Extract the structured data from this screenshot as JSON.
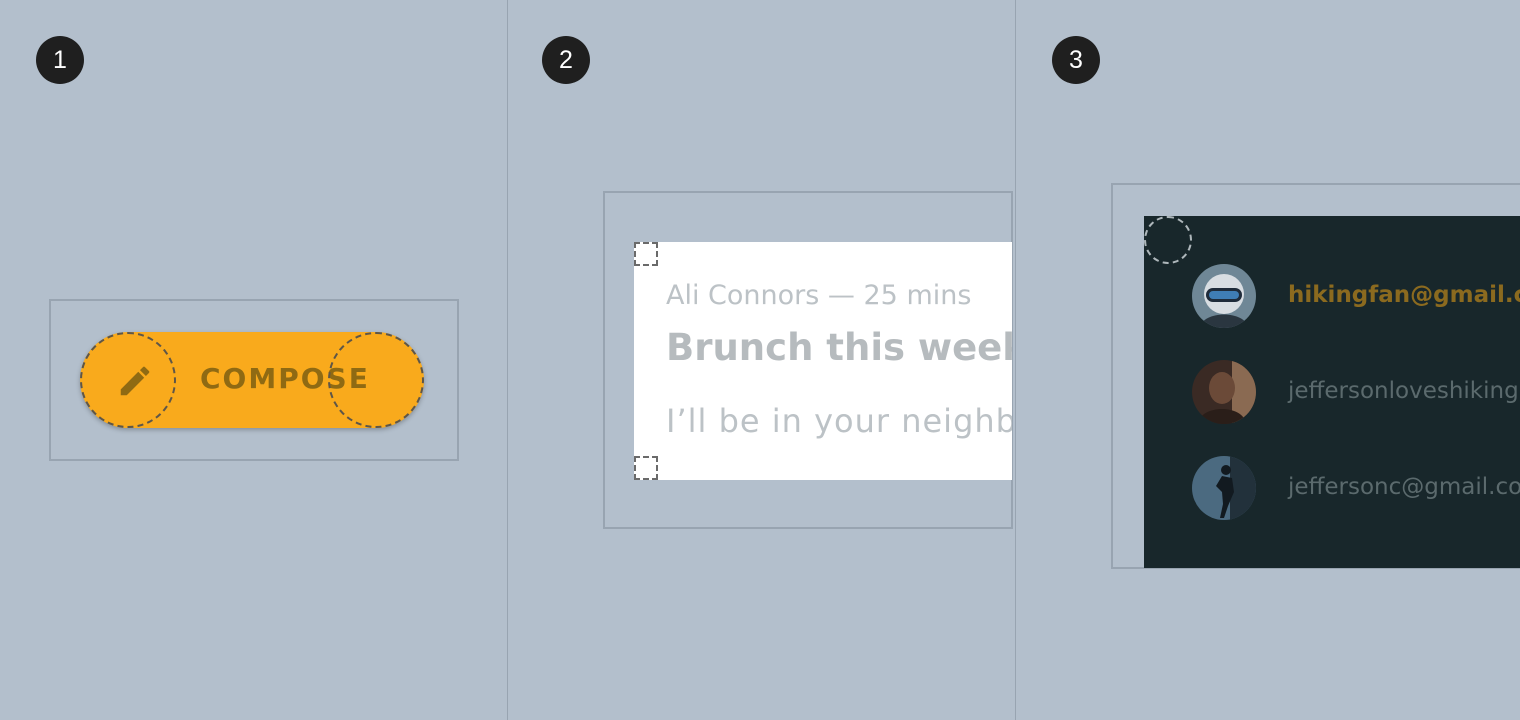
{
  "steps": [
    "1",
    "2",
    "3"
  ],
  "compose": {
    "label": "COMPOSE",
    "icon": "pencil-icon",
    "color": "#f9aa1c"
  },
  "email_card": {
    "meta": "Ali Connors — 25 mins",
    "subject": "Brunch this weekend?",
    "preview": "I’ll be in your neighborhood"
  },
  "accounts": {
    "items": [
      {
        "email": "hikingfan@gmail.com",
        "active": true,
        "avatar": "skier-avatar"
      },
      {
        "email": "jeffersonloveshiking@gmail.com",
        "active": false,
        "avatar": "portrait-avatar"
      },
      {
        "email": "jeffersonc@gmail.com",
        "active": false,
        "avatar": "climber-avatar"
      }
    ]
  },
  "colors": {
    "background": "#b3bfcc",
    "fab": "#f9aa1c",
    "fab_text": "#8f6a13",
    "accounts_bg": "#18272b",
    "active_account": "#8b6a1f"
  }
}
